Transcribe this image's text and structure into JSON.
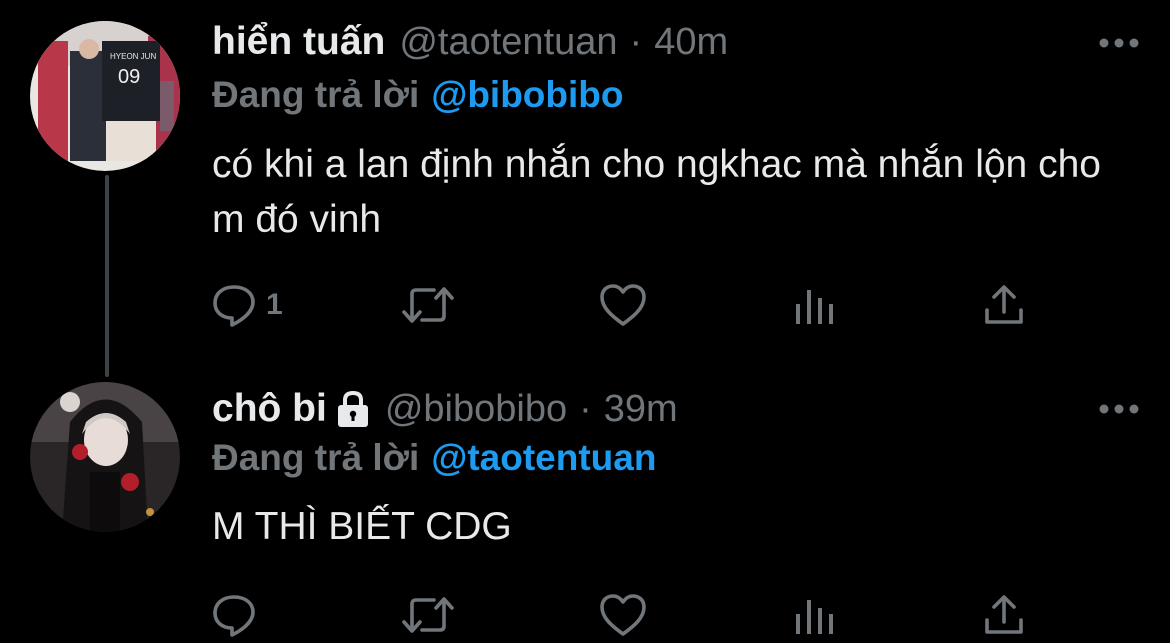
{
  "colors": {
    "background": "#000000",
    "text": "#e7e9ea",
    "muted": "#71767b",
    "accent": "#1d9bf0",
    "thread_line": "#3d4246"
  },
  "tweets": [
    {
      "name": "hiển tuấn",
      "handle": "@taotentuan",
      "separator": "·",
      "time": "40m",
      "replying_label": "Đang trả lời",
      "replying_to": "@bibobibo",
      "text": "có khi a lan định nhắn cho ngkhac mà nhắn lộn cho m đó vinh",
      "protected": false,
      "reply_count": "1",
      "icons": {
        "more": "more-horizontal-icon",
        "reply": "reply-icon",
        "retweet": "retweet-icon",
        "like": "heart-icon",
        "views": "analytics-icon",
        "share": "share-icon"
      }
    },
    {
      "name": "chô bi",
      "handle": "@bibobibo",
      "separator": "·",
      "time": "39m",
      "replying_label": "Đang trả lời",
      "replying_to": "@taotentuan",
      "text": "M THÌ BIẾT CDG",
      "protected": true,
      "reply_count": "",
      "icons": {
        "lock": "lock-icon",
        "more": "more-horizontal-icon",
        "reply": "reply-icon",
        "retweet": "retweet-icon",
        "like": "heart-icon",
        "views": "analytics-icon",
        "share": "share-icon"
      }
    }
  ]
}
